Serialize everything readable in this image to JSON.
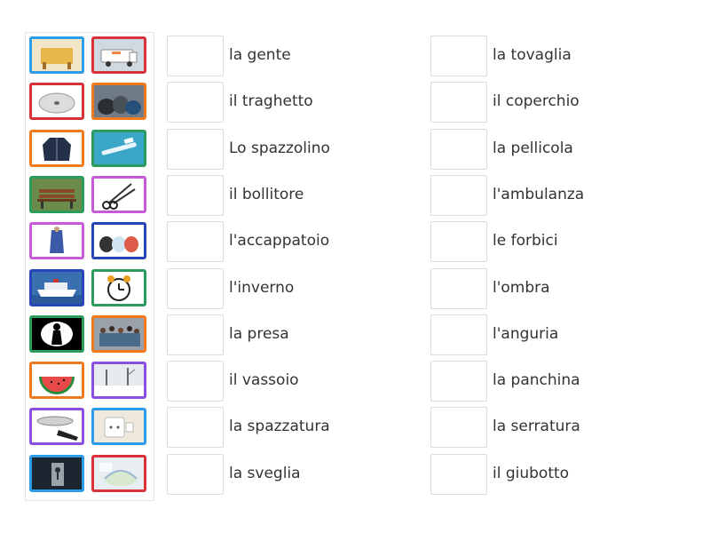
{
  "tiles": [
    {
      "icon": "tablecloth-icon",
      "border": "#2e9be8",
      "bg": "#f2e6c8"
    },
    {
      "icon": "ambulance-icon",
      "border": "#d9323a",
      "bg": "#cfd9e2"
    },
    {
      "icon": "pot-lid-icon",
      "border": "#d9323a",
      "bg": "#ffffff"
    },
    {
      "icon": "garbage-bags-icon",
      "border": "#ef7a1d",
      "bg": "#6f7b86"
    },
    {
      "icon": "jacket-icon",
      "border": "#ef7a1d",
      "bg": "#ffffff"
    },
    {
      "icon": "toothbrush-icon",
      "border": "#2a9c5e",
      "bg": "#3aa6c8"
    },
    {
      "icon": "park-bench-icon",
      "border": "#2a9c5e",
      "bg": "#6b8b4a"
    },
    {
      "icon": "scissors-icon",
      "border": "#c85ad9",
      "bg": "#ffffff"
    },
    {
      "icon": "bathrobe-icon",
      "border": "#c85ad9",
      "bg": "#ffffff"
    },
    {
      "icon": "kettles-icon",
      "border": "#2646b8",
      "bg": "#ffffff"
    },
    {
      "icon": "ferry-icon",
      "border": "#2646b8",
      "bg": "#3a6fb0"
    },
    {
      "icon": "alarm-clock-icon",
      "border": "#2a9c5e",
      "bg": "#ffffff"
    },
    {
      "icon": "shadow-icon",
      "border": "#2a9c5e",
      "bg": "#000000"
    },
    {
      "icon": "crowd-icon",
      "border": "#ef7a1d",
      "bg": "#9aa1a8"
    },
    {
      "icon": "watermelon-icon",
      "border": "#ef7a1d",
      "bg": "#ffffff"
    },
    {
      "icon": "winter-icon",
      "border": "#8a4fe0",
      "bg": "#e6e9ee"
    },
    {
      "icon": "tray-icon",
      "border": "#8a4fe0",
      "bg": "#ffffff"
    },
    {
      "icon": "power-socket-icon",
      "border": "#2e9be8",
      "bg": "#efe8dc"
    },
    {
      "icon": "door-lock-icon",
      "border": "#2e9be8",
      "bg": "#1c2630"
    },
    {
      "icon": "cling-film-icon",
      "border": "#d9323a",
      "bg": "#e9eef2"
    }
  ],
  "left_words": [
    "la gente",
    "il traghetto",
    "Lo spazzolino",
    "il bollitore",
    "l'accappatoio",
    "l'inverno",
    "la presa",
    "il vassoio",
    "la spazzatura",
    "la sveglia"
  ],
  "right_words": [
    "la tovaglia",
    "il coperchio",
    "la pellicola",
    "l'ambulanza",
    "le forbici",
    "l'ombra",
    "l'anguria",
    "la panchina",
    "la serratura",
    "il giubotto"
  ]
}
